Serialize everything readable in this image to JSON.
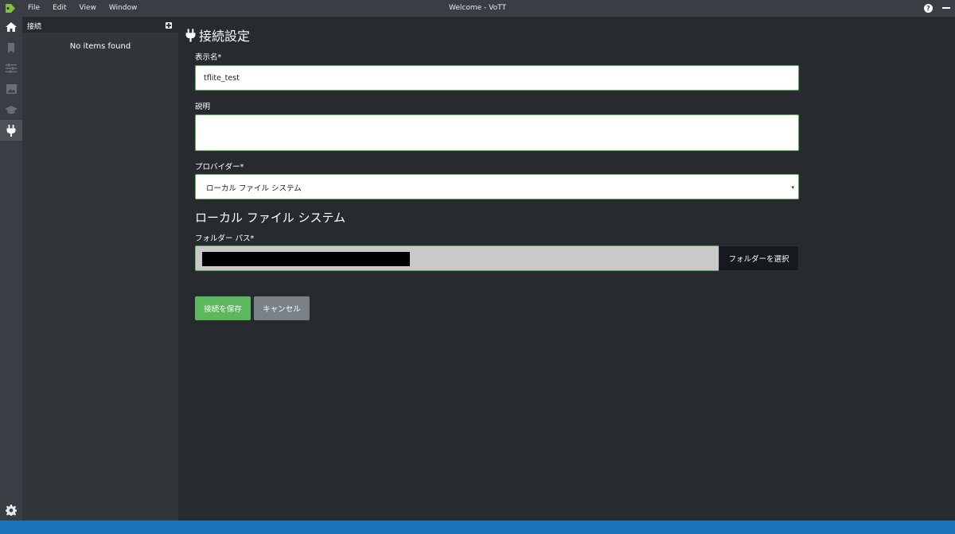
{
  "window": {
    "title": "Welcome - VoTT",
    "menu": [
      "File",
      "Edit",
      "View",
      "Window"
    ]
  },
  "rail": {
    "items": [
      "home-icon",
      "bookmark-icon",
      "sliders-icon",
      "image-icon",
      "graduation-cap-icon",
      "plug-icon"
    ],
    "active": "plug-icon",
    "footer_icon": "gear-icon"
  },
  "panel": {
    "title": "接続",
    "empty_text": "No items found"
  },
  "form": {
    "page_title": "接続設定",
    "display_name_label": "表示名*",
    "display_name_value": "tflite_test",
    "description_label": "説明",
    "description_value": "",
    "provider_label": "プロバイダー*",
    "provider_value": "ローカル ファイル システム",
    "provider_caret": "▾",
    "section_heading": "ローカル ファイル システム",
    "folder_path_label": "フォルダー パス*",
    "select_folder_button": "フォルダーを選択",
    "save_button": "接続を保存",
    "cancel_button": "キャンセル"
  },
  "colors": {
    "background": "#272b30",
    "chrome": "#3a3e44",
    "accent_green": "#5cb85c",
    "status_blue": "#1b75bb"
  }
}
